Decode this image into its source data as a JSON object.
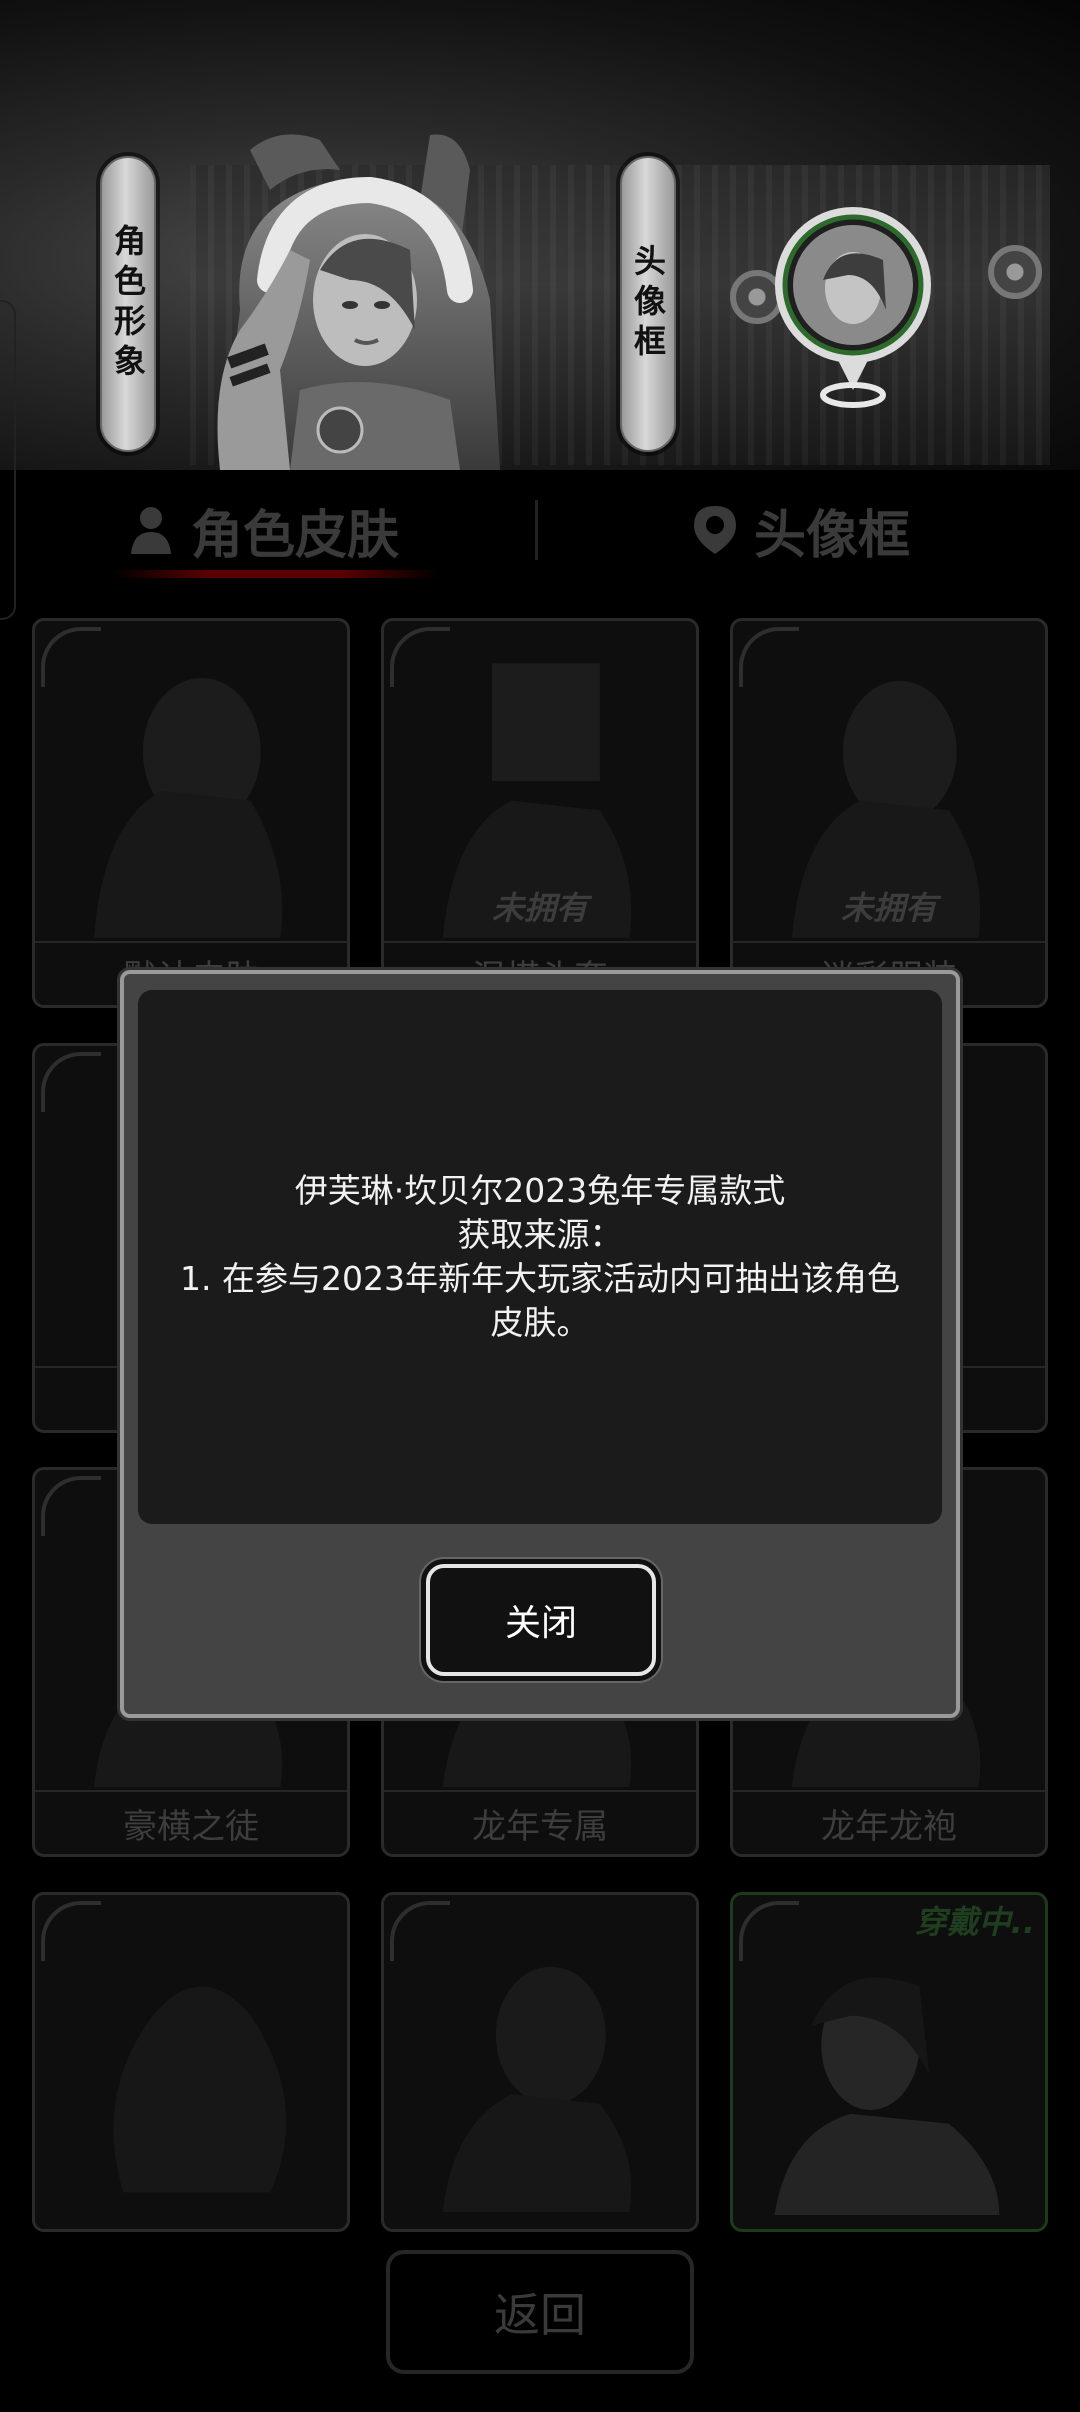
{
  "banner": {
    "character_label": "角色形象",
    "frame_label": "头像框"
  },
  "tabs": [
    {
      "label": "角色皮肤",
      "active": true
    },
    {
      "label": "头像框",
      "active": false
    }
  ],
  "cards": [
    {
      "name": "默认皮肤",
      "status": ""
    },
    {
      "name": "混搭头套",
      "status": "未拥有"
    },
    {
      "name": "迷彩服装",
      "status": "未拥有"
    },
    {
      "name": "",
      "status": ""
    },
    {
      "name": "",
      "status": ""
    },
    {
      "name": "",
      "status": ""
    },
    {
      "name": "豪横之徒",
      "status": ""
    },
    {
      "name": "龙年专属",
      "status": ""
    },
    {
      "name": "龙年龙袍",
      "status": ""
    },
    {
      "name": "",
      "status": ""
    },
    {
      "name": "",
      "status": ""
    },
    {
      "name": "",
      "status": "穿戴中.."
    }
  ],
  "back_label": "返回",
  "modal": {
    "line1": "伊芙琳·坎贝尔2023兔年专属款式",
    "line2": "获取来源：",
    "line3": "1. 在参与2023年新年大玩家活动内可抽出该角色皮肤。",
    "close_label": "关闭"
  },
  "colors": {
    "modal_frame": "#444444",
    "modal_panel": "#1b1b1b",
    "equipped_accent": "#1f3d1f"
  }
}
